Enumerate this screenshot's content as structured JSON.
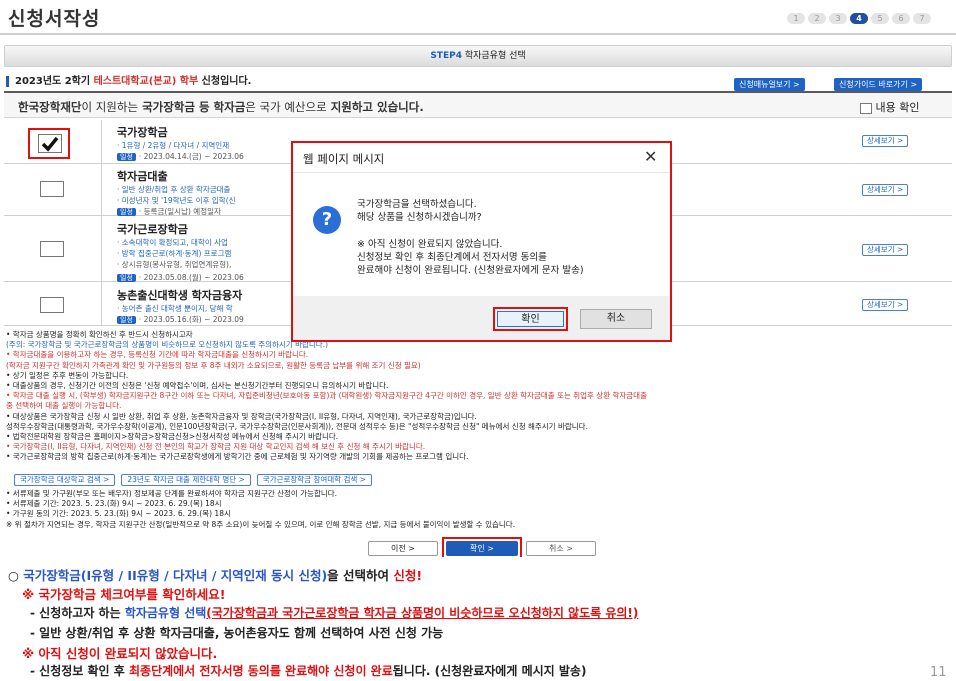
{
  "page": {
    "title": "신청서작성",
    "steps": [
      "1",
      "2",
      "3",
      "4",
      "5",
      "6",
      "7"
    ],
    "active_step": "4",
    "step_banner": {
      "step": "STEP4",
      "text": "학자금유형 선택"
    },
    "page_number": "11"
  },
  "semester": {
    "prefix": "2023년도 2학기",
    "school": "테스트대학교(본교) 학부",
    "suffix": "신청입니다.",
    "manual_button": "신청매뉴얼보기 >",
    "guide_button": "신청가이드 바로가기 >"
  },
  "notice": {
    "org": "한국장학재단",
    "text1": "이 지원하는",
    "product": "국가장학금 등 학자금",
    "text2": "은 국가 예산으로",
    "emphasis": "지원하고 있습니다.",
    "confirm_label": "내용 확인"
  },
  "products": [
    {
      "name": "국가장학금",
      "line1": "· 1유형 / 2유형 / 다자녀 / 지역인재",
      "line2": "",
      "date_tag": "일정",
      "date": "· 2023.04.14.(금) ~ 2023.06",
      "detail": "상세보기 >"
    },
    {
      "name": "학자금대출",
      "line1": "· 일반 상환/취업 후 상환 학자금대출",
      "line2": "· 미성년자 및 '19학년도 이후 입학(신",
      "date_tag": "일정",
      "date": "· 등록금(일시납) 예정일자",
      "detail": "상세보기 >"
    },
    {
      "name": "국가근로장학금",
      "line1": "· 소속대학이 확정되고, 대학이 사업",
      "line2": "· 방학 집중근로(하계·동계) 프로그램",
      "line3": "· 상시유형(봉사유형, 취업연계유형),",
      "date_tag": "일정",
      "date": "· 2023.05.08.(월) ~ 2023.06",
      "detail": "상세보기 >"
    },
    {
      "name": "농촌출신대학생 학자금융자",
      "line1": "· 농어촌 출신 대학생 뿐이지, 당해 학",
      "line2": "",
      "date_tag": "일정",
      "date": "· 2023.05.16.(화) ~ 2023.09",
      "detail": "상세보기 >"
    }
  ],
  "notes": [
    {
      "style": "",
      "text": "• 학자금 상품명을 정확히 확인하신 후 반드시 신청하시고자"
    },
    {
      "style": "blue",
      "text": "(주의: 국가장학금 및 국가근로장학금의 상품명이 비슷하므로 오신청하지 않도록 주의하시기 바랍니다.)"
    },
    {
      "style": "red",
      "text": "• 학자금대출을 이용하고자 하는 경우, 등록신청 기간에 따라 학자금대출을 신청하시기 바랍니다."
    },
    {
      "style": "red",
      "text": "(학자금 지원구간 확인하지 가족관계 확인 및 가구원등의 정보 후 8주 내외가 소요되므로, 원활한 등록금 납부를 위해 조기 신청 필요)"
    },
    {
      "style": "",
      "text": "• 상기 일정은 추후 변동이 가능합니다."
    },
    {
      "style": "",
      "text": "• 대출상품의 경우, 신청기간 이전의 신청은 '신청 예약접수'이며, 심사는 본신청기간부터 진행되오니 유의하시기 바랍니다."
    },
    {
      "style": "red",
      "text": "• 학자금 대출 실행 시, (학부생) 학자금지원구간 8구간 이하 또는 다자녀, 자립준비청년(보호아동 포함)과 (대학원생) 학자금지원구간 4구간 이하인 경우, 일반 상환 학자금대출 또는 취업후 상환 학자금대출"
    },
    {
      "style": "red",
      "text": "중 선택하여 대출 실행이 가능합니다."
    },
    {
      "style": "",
      "text": "• 대상상품은 국가장학금 신청 시 일반 상환, 취업 후 상환, 농촌학자금융자 및 장학금(국가장학금(I, II유형, 다자녀, 지역인재), 국가근로장학금)입니다."
    },
    {
      "style": "",
      "text": "성적우수장학금(대통령과학, 국가우수장학(이공계), 인문100년장학금(구, 국가우수장학금(인문사회계)), 전문대 성적우수 등)은 \"성적우수장학금 신청\" 메뉴에서 신청 해주시기 바랍니다."
    },
    {
      "style": "",
      "text": "• 법학전문대학원 장학금은 홈페이지>장학금>장학금신청>신청서작성 메뉴에서 신청해 주시기 바랍니다."
    },
    {
      "style": "red",
      "text": "• 국가장학금(I, II유형, 다자녀, 지역인재) 신청 전 본인의 학교가 장학금 지원 대상 학교인지 검색 해 보신 후 신청 해 주시기 바랍니다."
    },
    {
      "style": "",
      "text": "• 국가근로장학금의 방학 집중근로(하계·동계)는 국가근로장학생에게 방학기간 중에 근로체험 및 자기역량 개발의 기회를 제공하는 프로그램 입니다."
    }
  ],
  "link_buttons": [
    "국가장학금 대상학교 검색 >",
    "23년도 학자금 대출 제한대학 명단 >",
    "국가근로장학금 참여대학 검색 >"
  ],
  "notes2": [
    "• 서류제출 및 가구원(부모 또는 배우자) 정보제공 단계를 완료하셔야 학자금 지원구간 산정이 가능합니다.",
    "• 서류제출 기간: 2023. 5. 23.(화) 9시 ~ 2023. 6. 29.(목) 18시",
    "• 가구원 동의 기간: 2023. 5. 23.(화) 9시 ~ 2023. 6. 29.(목) 18시",
    "※ 위 절차가 지연되는 경우, 학자금 지원구간 산정(일반적으로 약 8주 소요)이 늦어질 수 있으며, 이로 인해 장학금 선발, 지급 등에서 불이익이 발생할 수 있습니다."
  ],
  "nav": {
    "prev": "이전 >",
    "ok": "확인 >",
    "cancel": "취소 >"
  },
  "dialog": {
    "title": "웹 페이지 메시지",
    "close": "✕",
    "icon": "?",
    "msg1": "국가장학금을 선택하셨습니다.",
    "msg2": "해당 상품을 신청하시겠습니까?",
    "msg3": "※ 아직 신청이 완료되지 않았습니다.",
    "msg4": "신청정보 확인 후 최종단계에서 전자서명 동의를",
    "msg5": "완료해야 신청이 완료됩니다. (신청완료자에게 문자 발송)",
    "ok": "확인",
    "cancel": "취소"
  },
  "instructions": {
    "l1_prefix": "○",
    "l1_blue": "국가장학금(I유형 / II유형 / 다자녀 / 지역인재 동시 신청)",
    "l1_mid": "을 선택하여",
    "l1_red": "신청!",
    "l2": "※ 국가장학금 체크여부를 확인하세요!",
    "l3_a": "- 신청하고자 하는",
    "l3_blue": "학자금유형 선택",
    "l3_red": "(국가장학금과 국가근로장학금 학자금 상품명이 비슷하므로 오신청하지 않도록 유의!)",
    "l4": "- 일반 상환/취업 후 상환 학자금대출, 농어촌융자도 함께 선택하여 사전 신청 가능",
    "l5": "※ 아직 신청이 완료되지 않았습니다.",
    "l6_a": "- 신청정보 확인 후",
    "l6_red": "최종단계에서 전자서명 동의를 완료해야 신청이 완료",
    "l6_b": "됩니다. (신청완료자에게 메시지 발송)"
  },
  "colors": {
    "accent": "#1f5cb8",
    "red": "#e01010",
    "blue": "#2a55c6"
  }
}
